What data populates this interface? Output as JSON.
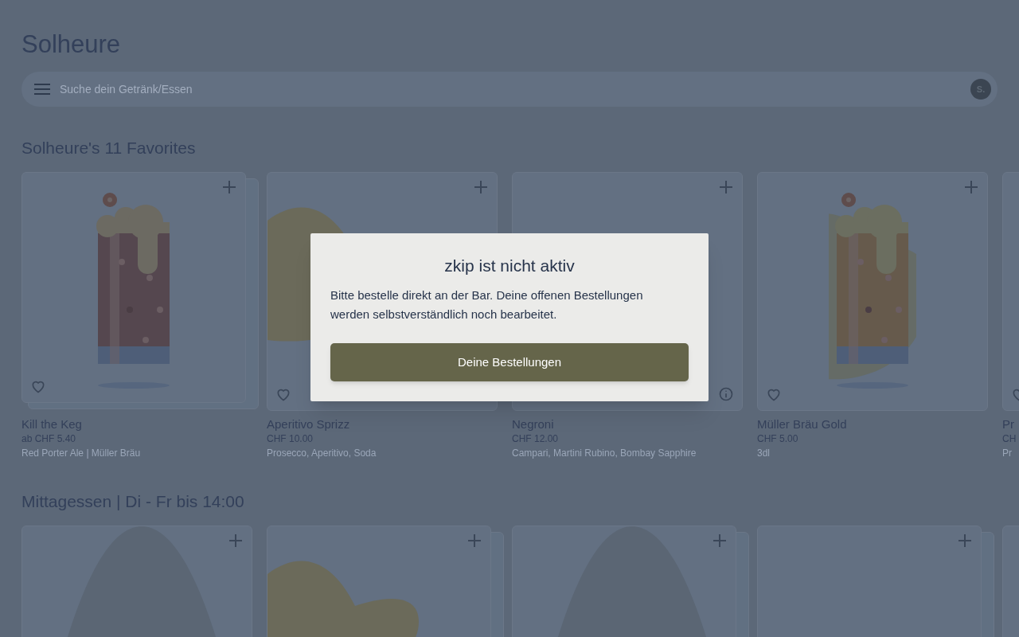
{
  "header": {
    "title": "Solheure"
  },
  "search": {
    "placeholder": "Suche dein Getränk/Essen",
    "avatar": "S."
  },
  "sections": [
    {
      "title": "Solheure's 11 Favorites",
      "items": [
        {
          "kind": "beer-dark",
          "name": "Kill the Keg",
          "price": "ab CHF 5.40",
          "description": "Red Porter Ale | Müller Bräu",
          "stacked": true,
          "add": true,
          "heart": true
        },
        {
          "kind": "blob",
          "name": "Aperitivo Sprizz",
          "price": "CHF 10.00",
          "description": "Prosecco, Aperitivo, Soda",
          "stacked": false,
          "add": true,
          "heart": true
        },
        {
          "kind": "empty",
          "name": "Negroni",
          "price": "CHF 12.00",
          "description": "Campari, Martini Rubino, Bombay Sapphire",
          "stacked": false,
          "info": true,
          "add": true
        },
        {
          "kind": "beer-light",
          "name": "Müller Bräu Gold",
          "price": "CHF 5.00",
          "description": "3dl",
          "stacked": false,
          "add": true,
          "heart": true
        },
        {
          "kind": "empty",
          "name": "Pr",
          "price": "CH",
          "description": "Pr",
          "stacked": false,
          "heart": true
        }
      ]
    },
    {
      "title": "Mittagessen | Di - Fr bis 14:00",
      "items": [
        {
          "kind": "arch",
          "stacked": false,
          "add": true
        },
        {
          "kind": "blob",
          "stacked": true,
          "add": true
        },
        {
          "kind": "arch",
          "stacked": true,
          "add": true
        },
        {
          "kind": "empty",
          "stacked": true,
          "add": true
        },
        {
          "kind": "empty"
        }
      ]
    }
  ],
  "dialog": {
    "title": "zkip ist nicht aktiv",
    "message": "Bitte bestelle direkt an der Bar. Deine offenen Bestellungen werden selbstverständlich noch bearbeitet.",
    "button": "Deine Bestellungen"
  }
}
